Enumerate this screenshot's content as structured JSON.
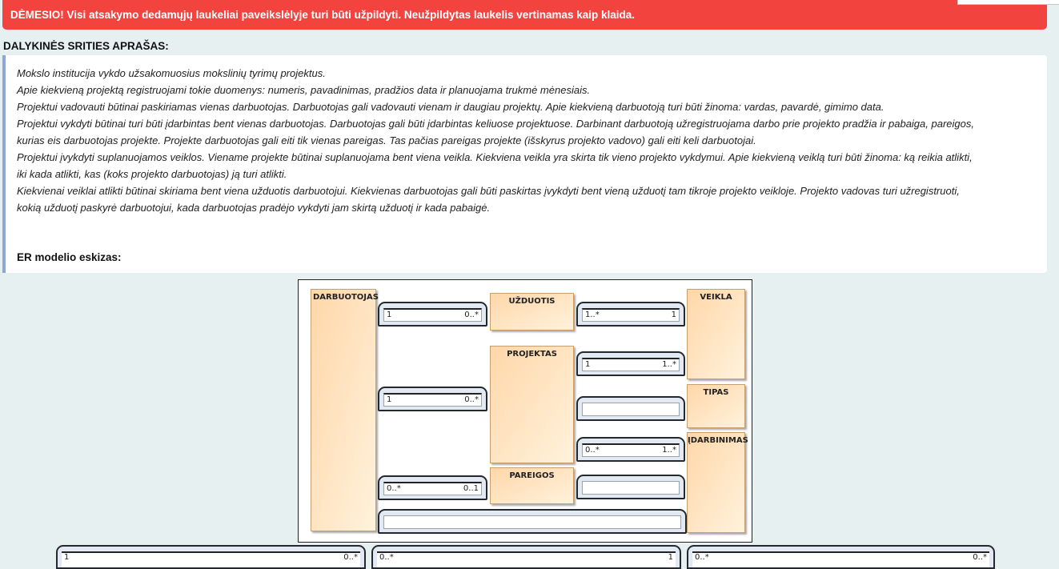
{
  "alert": {
    "text": "DĖMESIO! Visi atsakymo dedamųjų laukeliai paveikslėlyje turi būti užpildyti. Neužpildytas laukelis vertinamas kaip klaida."
  },
  "section": {
    "heading": "DALYKINĖS SRITIES APRAŠAS:"
  },
  "description": {
    "lines": [
      "Mokslo institucija vykdo užsakomuosius mokslinių tyrimų projektus.",
      "Apie kiekvieną projektą registruojami tokie duomenys: numeris, pavadinimas, pradžios data ir planuojama trukmė mėnesiais.",
      "Projektui vadovauti būtinai paskiriamas vienas darbuotojas. Darbuotojas gali vadovauti vienam ir daugiau projektų. Apie kiekvieną darbuotoją turi būti žinoma: vardas, pavardė, gimimo data.",
      "Projektui vykdyti būtinai turi būti įdarbintas bent vienas darbuotojas. Darbuotojas gali būti įdarbintas keliuose projektuose. Darbinant darbuotoją užregistruojama darbo prie projekto pradžia ir pabaiga, pareigos,",
      "kurias eis darbuotojas projekte. Projekte darbuotojas gali eiti tik vienas pareigas. Tas pačias pareigas projekte (išskyrus projekto vadovo) gali eiti keli darbuotojai.",
      "Projektui įvykdyti suplanuojamos veiklos. Viename projekte būtinai suplanuojama bent viena veikla. Kiekviena veikla yra skirta tik vieno projekto vykdymui. Apie kiekvieną veiklą turi būti žinoma: ką reikia atlikti,",
      "iki kada atlikti, kas (koks projekto darbuotojas) ją turi atlikti.",
      "Kiekvienai veiklai atlikti būtinai skiriama bent viena užduotis darbuotojui. Kiekvienas darbuotojas gali būti paskirtas įvykdyti bent vieną užduotį tam tikroje projekto veikloje. Projekto vadovas turi užregistruoti,",
      "kokią užduotį paskyrė darbuotojui, kada darbuotojas pradėjo vykdyti jam skirtą užduotį ir kada pabaigė."
    ],
    "er_label": "ER modelio eskizas:"
  },
  "diagram": {
    "entities": {
      "darbuotojas": "DARBUOTOJAS",
      "uzduotis": "UŽDUOTIS",
      "projektas": "PROJEKTAS",
      "pareigos": "PAREIGOS",
      "veikla": "VEIKLA",
      "tipas": "TIPAS",
      "idarbinimas": "ĮDARBINIMAS"
    },
    "relations": {
      "r1": {
        "left": "1",
        "right": "0..*"
      },
      "r2": {
        "left": "1",
        "right": "0..*"
      },
      "r3": {
        "left": "0..*",
        "right": "0..1"
      },
      "r4": {
        "left": "1..*",
        "right": "1"
      },
      "r5": {
        "left": "1",
        "right": "1..*"
      },
      "r6": {
        "left": "",
        "right": ""
      },
      "r7": {
        "left": "0..*",
        "right": "1..*"
      },
      "r8": {
        "left": "",
        "right": ""
      },
      "r9": {
        "left": "",
        "right": ""
      }
    }
  },
  "answer_slots": [
    {
      "left": "1",
      "right": "0..*"
    },
    {
      "left": "0..*",
      "right": "1"
    },
    {
      "left": "0..*",
      "right": "0..*"
    }
  ]
}
